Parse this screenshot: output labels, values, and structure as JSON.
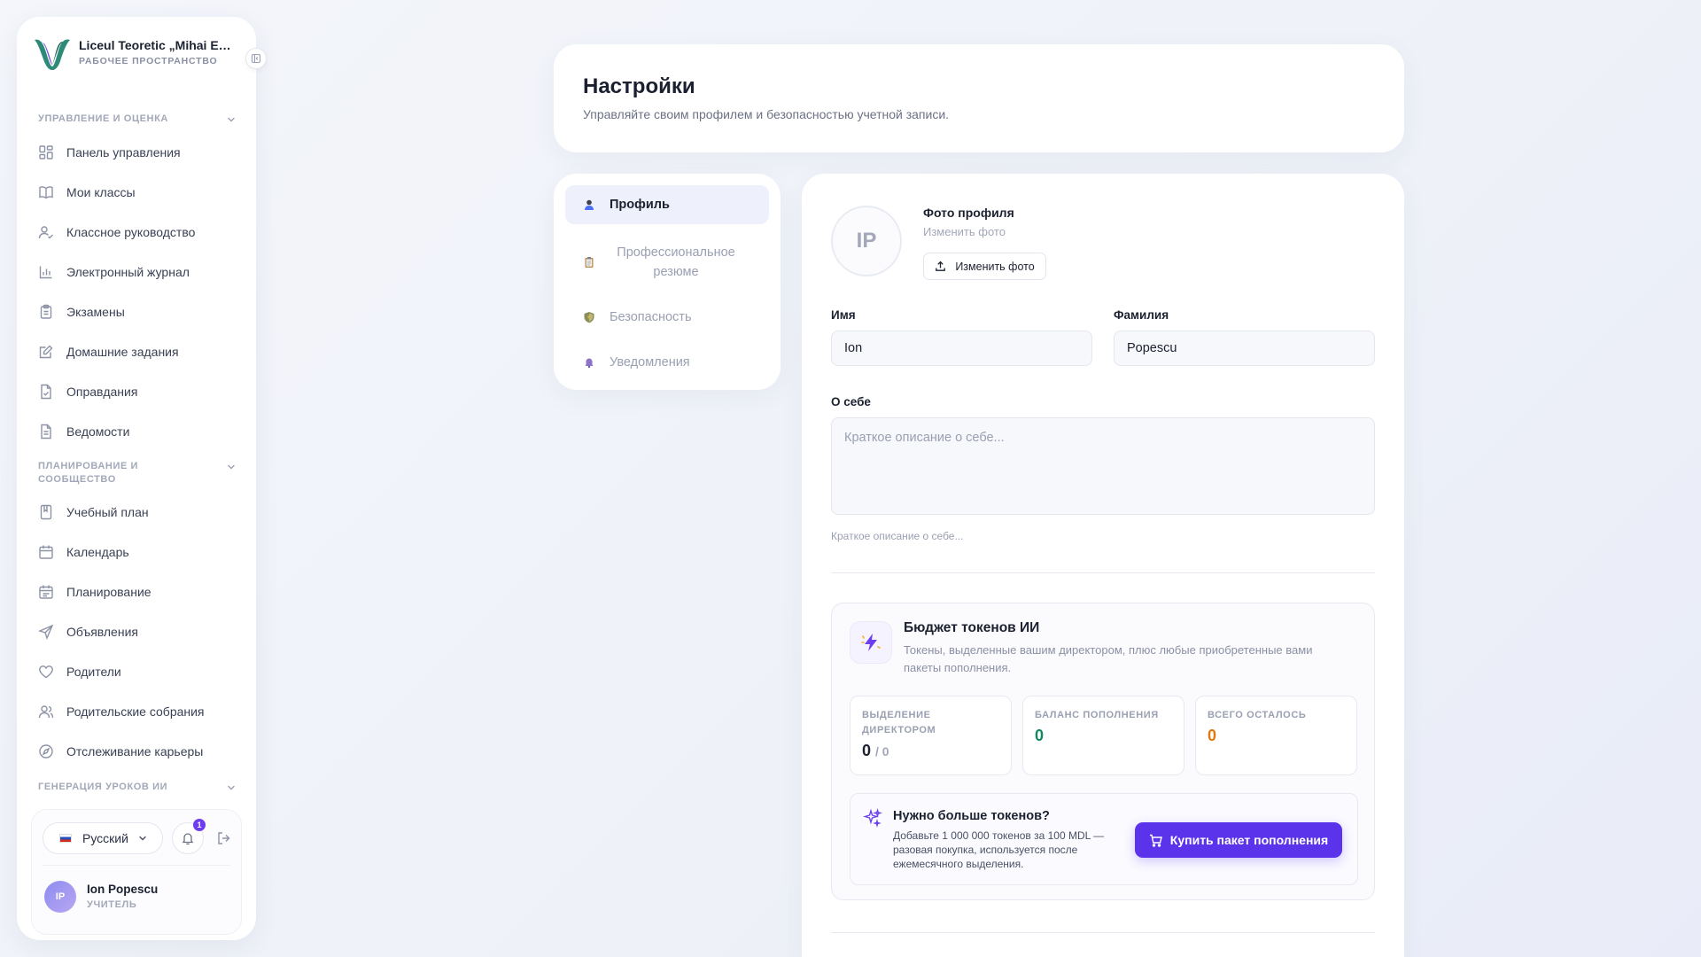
{
  "sidebar": {
    "brand_name": "Liceul Teoretic „Mihai Emi...",
    "brand_sub": "РАБОЧЕЕ ПРОСТРАНСТВО",
    "sections": [
      {
        "title": "УПРАВЛЕНИЕ И ОЦЕНКА"
      },
      {
        "title": "ПЛАНИРОВАНИЕ И СООБЩЕСТВО"
      },
      {
        "title": "ГЕНЕРАЦИЯ УРОКОВ ИИ"
      }
    ],
    "items": [
      {
        "label": "Панель управления",
        "icon": "dashboard-icon"
      },
      {
        "label": "Мои классы",
        "icon": "book-icon"
      },
      {
        "label": "Классное руководство",
        "icon": "user-check-icon"
      },
      {
        "label": "Электронный журнал",
        "icon": "bar-chart-icon"
      },
      {
        "label": "Экзамены",
        "icon": "clipboard-icon"
      },
      {
        "label": "Домашние задания",
        "icon": "edit-icon"
      },
      {
        "label": "Оправдания",
        "icon": "file-check-icon"
      },
      {
        "label": "Ведомости",
        "icon": "file-text-icon"
      },
      {
        "label": "Учебный план",
        "icon": "notebook-icon"
      },
      {
        "label": "Календарь",
        "icon": "calendar-icon"
      },
      {
        "label": "Планирование",
        "icon": "calendar-plan-icon"
      },
      {
        "label": "Объявления",
        "icon": "send-icon"
      },
      {
        "label": "Родители",
        "icon": "heart-icon"
      },
      {
        "label": "Родительские собрания",
        "icon": "users-icon"
      },
      {
        "label": "Отслеживание карьеры",
        "icon": "compass-icon"
      }
    ],
    "language": "Русский",
    "notifications_count": "1",
    "user": {
      "initials": "IP",
      "name": "Ion Popescu",
      "role": "УЧИТЕЛЬ"
    }
  },
  "header": {
    "title": "Настройки",
    "subtitle": "Управляйте своим профилем и безопасностью учетной записи."
  },
  "tabs": [
    {
      "label": "Профиль",
      "active": true
    },
    {
      "label": "Профессиональное резюме",
      "active": false
    },
    {
      "label": "Безопасность",
      "active": false
    },
    {
      "label": "Уведомления",
      "active": false
    }
  ],
  "profile": {
    "initials": "IP",
    "photo_title": "Фото профиля",
    "photo_subtitle": "Изменить фото",
    "photo_button": "Изменить фото",
    "first_name_label": "Имя",
    "first_name_value": "Ion",
    "last_name_label": "Фамилия",
    "last_name_value": "Popescu",
    "about_label": "О себе",
    "about_placeholder": "Краткое описание о себе...",
    "about_hint": "Краткое описание о себе..."
  },
  "tokens": {
    "title": "Бюджет токенов ИИ",
    "description": "Токены, выделенные вашим директором, плюс любые приобретенные вами пакеты пополнения.",
    "stats": [
      {
        "label": "ВЫДЕЛЕНИЕ ДИРЕКТОРОМ",
        "value": "0",
        "of": "/ 0",
        "color": "#1c2130"
      },
      {
        "label": "БАЛАНС ПОПОЛНЕНИЯ",
        "value": "0",
        "color": "#0f8a5f"
      },
      {
        "label": "ВСЕГО ОСТАЛОСЬ",
        "value": "0",
        "color": "#e0780e"
      }
    ],
    "need_title": "Нужно больше токенов?",
    "need_desc": "Добавьте 1 000 000 токенов за 100 MDL — разовая покупка, используется после ежемесячного выделения.",
    "buy_button": "Купить пакет пополнения"
  },
  "colors": {
    "accent": "#5b33ea",
    "brand": "#1f7a6b"
  }
}
